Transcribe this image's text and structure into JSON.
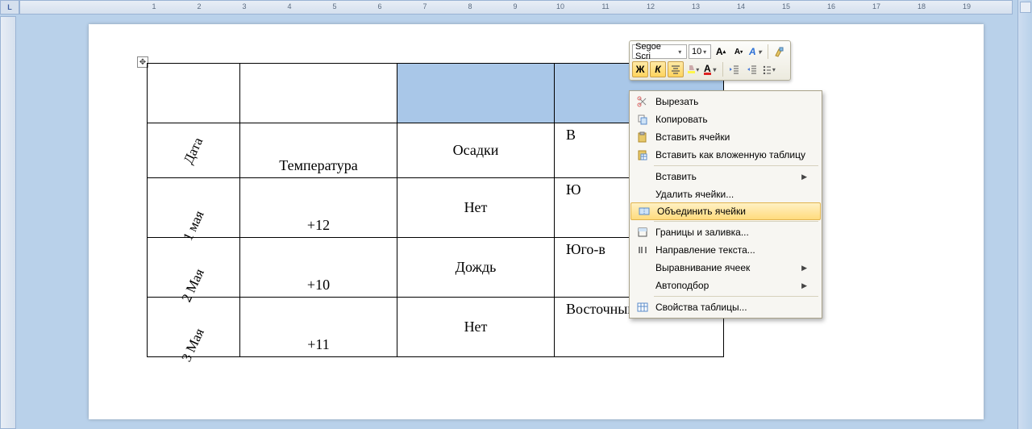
{
  "ruler": {
    "max": 19
  },
  "corner": "L",
  "mini_toolbar": {
    "font_name": "Segoe Scri",
    "font_size": "10",
    "bold": "Ж",
    "italic": "К"
  },
  "context_menu": {
    "cut": "Вырезать",
    "copy": "Копировать",
    "paste_cells": "Вставить ячейки",
    "paste_nested": "Вставить как вложенную таблицу",
    "insert": "Вставить",
    "delete_cells": "Удалить ячейки...",
    "merge_cells": "Объединить ячейки",
    "borders_fill": "Границы и заливка...",
    "text_direction": "Направление текста...",
    "cell_align": "Выравнивание ячеек",
    "autofit": "Автоподбор",
    "table_props": "Свойства таблицы..."
  },
  "table": {
    "headers": {
      "date": "Дата",
      "temp": "Температура",
      "precip": "Осадки",
      "wind_partial": "В"
    },
    "rows": [
      {
        "date": "1 мая",
        "temp": "+12",
        "precip": "Нет",
        "wind": "Ю"
      },
      {
        "date": "2 Мая",
        "temp": "+10",
        "precip": "Дождь",
        "wind": "Юго-в"
      },
      {
        "date": "3 Мая",
        "temp": "+11",
        "precip": "Нет",
        "wind": "Восточный"
      }
    ]
  }
}
